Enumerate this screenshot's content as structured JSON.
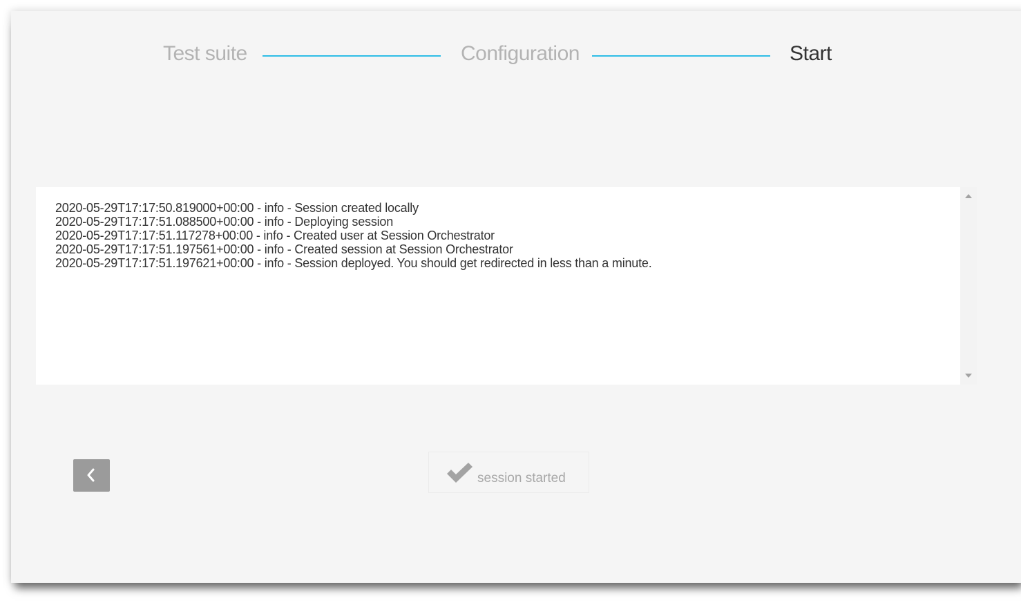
{
  "stepper": {
    "steps": [
      {
        "label": "Test suite",
        "state": "done"
      },
      {
        "label": "Configuration",
        "state": "done"
      },
      {
        "label": "Start",
        "state": "active"
      }
    ],
    "connector_color": "#2dbde6"
  },
  "log": {
    "lines": [
      "2020-05-29T17:17:50.819000+00:00 - info - Session created locally",
      "2020-05-29T17:17:51.088500+00:00 - info - Deploying session",
      "2020-05-29T17:17:51.117278+00:00 - info - Created user at Session Orchestrator",
      "2020-05-29T17:17:51.197561+00:00 - info - Created session at Session Orchestrator",
      "2020-05-29T17:17:51.197621+00:00 - info - Session deployed. You should get redirected in less than a minute."
    ]
  },
  "actions": {
    "back_icon": "chevron-left-icon",
    "status_icon": "checkmark-icon",
    "status_label": "session started"
  }
}
